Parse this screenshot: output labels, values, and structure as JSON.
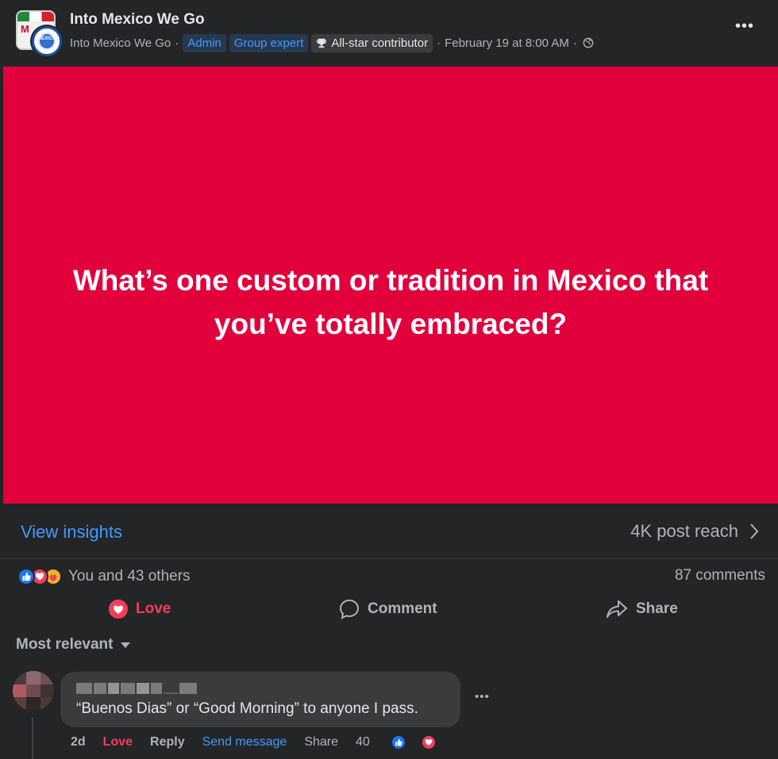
{
  "post": {
    "group_name": "Into Mexico We Go",
    "author": "Into Mexico We Go",
    "badges": [
      "Admin",
      "Group expert"
    ],
    "contributor_badge": "All-star contributor",
    "timestamp": "February 19 at 8:00 AM",
    "image_text": "What’s one custom or tradition in Mexico that you’ve totally embraced?",
    "image_bg_color": "#e2003c"
  },
  "insights": {
    "view_label": "View insights",
    "reach": "4K post reach"
  },
  "reactions": {
    "summary": "You and 43 others",
    "comments": "87 comments",
    "types": [
      "like-icon",
      "love-icon",
      "care-icon"
    ]
  },
  "actions": {
    "love": "Love",
    "comment": "Comment",
    "share": "Share"
  },
  "comments_sort": "Most relevant",
  "comment": {
    "text": "“Buenos Dias” or “Good Morning” to anyone I pass.",
    "time": "2d",
    "love": "Love",
    "reply": "Reply",
    "send_message": "Send message",
    "share": "Share",
    "reaction_count": "40"
  },
  "colors": {
    "background": "#242526",
    "accent_blue": "#4599ff",
    "love_red": "#f33e58"
  }
}
